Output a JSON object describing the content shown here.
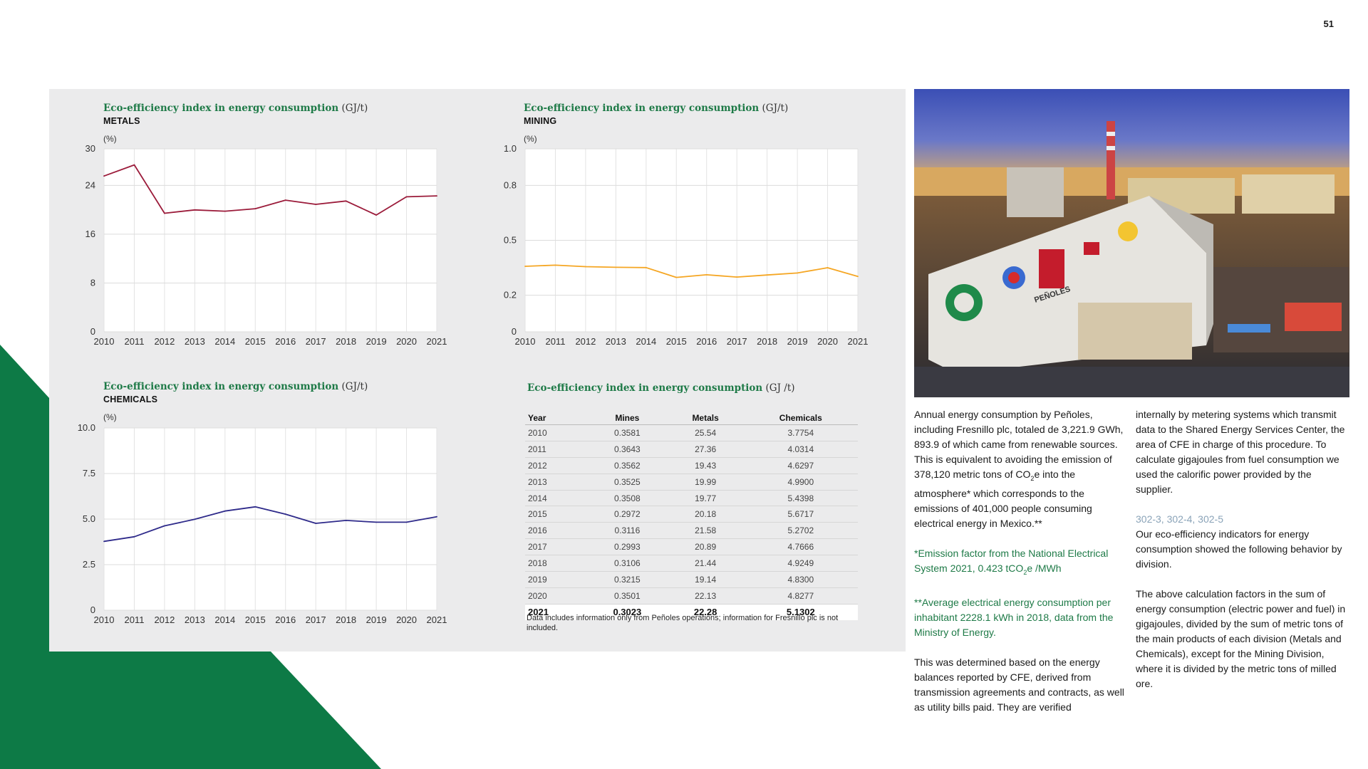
{
  "page_number": "51",
  "colors": {
    "brand_green": "#0d7a46",
    "panel_bg": "#ebebec",
    "metals_line": "#9b1b3a",
    "mining_line": "#f5a623",
    "chemicals_line": "#2e2a8a"
  },
  "charts": [
    {
      "id": "metals",
      "title_main": "Eco-efficiency index in energy consumption",
      "title_unit": " (GJ/t)",
      "subtitle": "METALS",
      "unit_label": "(%)",
      "color": "#9b1b3a",
      "ylim": [
        0,
        30
      ],
      "yticks": [
        0,
        8,
        16,
        24,
        30
      ],
      "yticklabels": [
        "0",
        "8",
        "16",
        "24",
        "30"
      ]
    },
    {
      "id": "mining",
      "title_main": "Eco-efficiency index in energy consumption",
      "title_unit": " (GJ/t)",
      "subtitle": "MINING",
      "unit_label": "(%)",
      "color": "#f5a623",
      "ylim": [
        0,
        1.0
      ],
      "yticks": [
        0,
        0.2,
        0.5,
        0.8,
        1.0
      ],
      "yticklabels": [
        "0",
        "0.2",
        "0.5",
        "0.8",
        "1.0"
      ]
    },
    {
      "id": "chemicals",
      "title_main": "Eco-efficiency index in energy consumption",
      "title_unit": " (GJ/t)",
      "subtitle": "CHEMICALS",
      "unit_label": "(%)",
      "color": "#2e2a8a",
      "ylim": [
        0,
        10.0
      ],
      "yticks": [
        0,
        2.5,
        5.0,
        7.5,
        10.0
      ],
      "yticklabels": [
        "0",
        "2.5",
        "5.0",
        "7.5",
        "10.0"
      ]
    }
  ],
  "chart_data": [
    {
      "type": "line",
      "title": "Eco-efficiency index in energy consumption (GJ/t) METALS",
      "ylabel": "(%)",
      "x": [
        "2010",
        "2011",
        "2012",
        "2013",
        "2014",
        "2015",
        "2016",
        "2017",
        "2018",
        "2019",
        "2020",
        "2021"
      ],
      "ylim": [
        0,
        30
      ],
      "series": [
        {
          "name": "Metals",
          "values": [
            25.54,
            27.36,
            19.43,
            19.99,
            19.77,
            20.18,
            21.58,
            20.89,
            21.44,
            19.14,
            22.13,
            22.28
          ]
        }
      ]
    },
    {
      "type": "line",
      "title": "Eco-efficiency index in energy consumption (GJ/t) MINING",
      "ylabel": "(%)",
      "x": [
        "2010",
        "2011",
        "2012",
        "2013",
        "2014",
        "2015",
        "2016",
        "2017",
        "2018",
        "2019",
        "2020",
        "2021"
      ],
      "ylim": [
        0,
        1.0
      ],
      "series": [
        {
          "name": "Mines",
          "values": [
            0.3581,
            0.3643,
            0.3562,
            0.3525,
            0.3508,
            0.2972,
            0.3116,
            0.2993,
            0.3106,
            0.3215,
            0.3501,
            0.3023
          ]
        }
      ]
    },
    {
      "type": "line",
      "title": "Eco-efficiency index in energy consumption (GJ/t) CHEMICALS",
      "ylabel": "(%)",
      "x": [
        "2010",
        "2011",
        "2012",
        "2013",
        "2014",
        "2015",
        "2016",
        "2017",
        "2018",
        "2019",
        "2020",
        "2021"
      ],
      "ylim": [
        0,
        10.0
      ],
      "series": [
        {
          "name": "Chemicals",
          "values": [
            3.7754,
            4.0314,
            4.6297,
            4.99,
            5.4398,
            5.6717,
            5.2702,
            4.7666,
            4.9249,
            4.83,
            4.8277,
            5.1302
          ]
        }
      ]
    },
    {
      "type": "table",
      "title": "Eco-efficiency index in energy consumption (GJ /t)",
      "headers": [
        "Year",
        "Mines",
        "Metals",
        "Chemicals"
      ]
    }
  ],
  "table": {
    "title_main": "Eco-efficiency index in energy consumption",
    "title_unit": " (GJ /t)",
    "headers": [
      "Year",
      "Mines",
      "Metals",
      "Chemicals"
    ],
    "rows": [
      [
        "2010",
        "0.3581",
        "25.54",
        "3.7754"
      ],
      [
        "2011",
        "0.3643",
        "27.36",
        "4.0314"
      ],
      [
        "2012",
        "0.3562",
        "19.43",
        "4.6297"
      ],
      [
        "2013",
        "0.3525",
        "19.99",
        "4.9900"
      ],
      [
        "2014",
        "0.3508",
        "19.77",
        "5.4398"
      ],
      [
        "2015",
        "0.2972",
        "20.18",
        "5.6717"
      ],
      [
        "2016",
        "0.3116",
        "21.58",
        "5.2702"
      ],
      [
        "2017",
        "0.2993",
        "20.89",
        "4.7666"
      ],
      [
        "2018",
        "0.3106",
        "21.44",
        "4.9249"
      ],
      [
        "2019",
        "0.3215",
        "19.14",
        "4.8300"
      ],
      [
        "2020",
        "0.3501",
        "22.13",
        "4.8277"
      ],
      [
        "2021",
        "0.3023",
        "22.28",
        "5.1302"
      ]
    ],
    "note": "Data includes information only from Peñoles operations; information for Fresnillo plc is not included."
  },
  "photo": {
    "signage": "PEÑOLES"
  },
  "text": {
    "col1_p1_a": "Annual energy consumption by Peñoles, including Fresnillo plc, totaled de 3,221.9 GWh, 893.9  of which came from renewable sources. This is equivalent to avoiding the emission of 378,120 metric tons of CO",
    "col1_p1_sub": "2",
    "col1_p1_b": "e into the atmosphere* which corresponds to the emissions of 401,000 people consuming electrical energy in Mexico.**",
    "col1_p2_a": "*Emission factor from the National Electrical System 2021, 0.423 tCO",
    "col1_p2_sub": "2",
    "col1_p2_b": "e /MWh",
    "col1_p3": "**Average electrical energy consumption per inhabitant 2228.1 kWh in 2018, data from the Ministry of Energy.",
    "col1_p4": "This was determined based on the energy balances reported by CFE, derived from transmission agreements and contracts, as well as utility bills paid. They are verified",
    "col2_p1": "internally by metering systems which transmit data to the Shared Energy Services Center, the area of CFE in charge of this procedure. To calculate gigajoules from fuel consumption we used the calorific power provided by the supplier.",
    "col2_gri": "302-3, 302-4, 302-5",
    "col2_p2": "Our eco-efficiency indicators for energy consumption showed the following behavior by division.",
    "col2_p3": "The above calculation factors in the sum of energy consumption (electric power and fuel) in gigajoules, divided by the sum of metric tons of the main products of each division (Metals and Chemicals), except for the Mining Division, where it is divided by the metric tons of milled ore."
  }
}
